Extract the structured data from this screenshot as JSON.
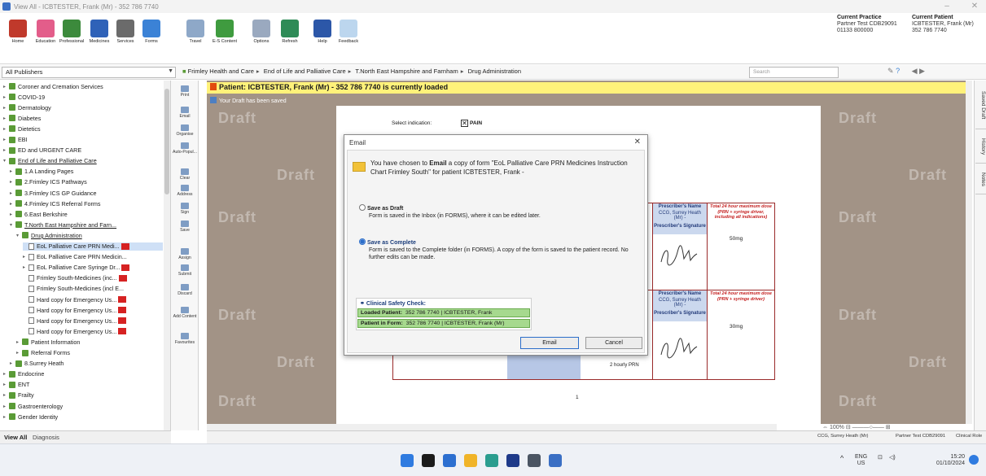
{
  "window": {
    "title": "View All - ICBTESTER, Frank (Mr) - 352 786 7740"
  },
  "ribbon": {
    "buttons": [
      "Home",
      "Education",
      "Professional",
      "Medicines",
      "Services",
      "Forms",
      "Travel",
      "E-S Content",
      "Options",
      "Refresh",
      "Help",
      "Feedback"
    ],
    "current_practice": {
      "heading": "Current Practice",
      "name": "Partner Test CDB29091",
      "phone": "01133 800000"
    },
    "current_patient": {
      "heading": "Current Patient",
      "name": "ICBTESTER, Frank (Mr)",
      "number": "352 786 7740"
    }
  },
  "navbar": {
    "publisher": "All Publishers",
    "breadcrumbs": [
      "Frimley Health and Care",
      "End of Life and Palliative Care",
      "T.North East Hampshire and Farnham",
      "Drug Administration"
    ],
    "search_placeholder": "Search"
  },
  "tree": {
    "items": [
      {
        "label": "Coroner and Cremation Services",
        "level": 1,
        "kind": "book",
        "expand": "▸"
      },
      {
        "label": "COVID-19",
        "level": 1,
        "kind": "book",
        "expand": "▸"
      },
      {
        "label": "Dermatology",
        "level": 1,
        "kind": "book",
        "expand": "▸"
      },
      {
        "label": "Diabetes",
        "level": 1,
        "kind": "book",
        "expand": "▸"
      },
      {
        "label": "Dietetics",
        "level": 1,
        "kind": "book",
        "expand": "▸"
      },
      {
        "label": "EBI",
        "level": 1,
        "kind": "book",
        "expand": "▸"
      },
      {
        "label": "ED and URGENT CARE",
        "level": 1,
        "kind": "book",
        "expand": "▸"
      },
      {
        "label": "End of Life and Palliative Care",
        "level": 1,
        "kind": "book",
        "expand": "▾",
        "link": true
      },
      {
        "label": "1.A Landing Pages",
        "level": 2,
        "kind": "book",
        "expand": "▸"
      },
      {
        "label": "2.Frimley ICS Pathways",
        "level": 2,
        "kind": "book",
        "expand": "▸"
      },
      {
        "label": "3.Frimley ICS GP Guidance",
        "level": 2,
        "kind": "book",
        "expand": "▸"
      },
      {
        "label": "4.Frimley ICS Referral Forms",
        "level": 2,
        "kind": "book",
        "expand": "▸"
      },
      {
        "label": "6.East Berkshire",
        "level": 2,
        "kind": "book",
        "expand": "▸"
      },
      {
        "label": "T.North East Hampshire and Farn...",
        "level": 2,
        "kind": "book",
        "expand": "▾",
        "link": true
      },
      {
        "label": "Drug Administration",
        "level": 3,
        "kind": "book",
        "expand": "▾",
        "link": true
      },
      {
        "label": "EoL Palliative Care PRN Medi...",
        "level": 4,
        "kind": "doc",
        "expand": "",
        "red": true,
        "selected": true
      },
      {
        "label": "EoL Palliative Care PRN Medicin...",
        "level": 4,
        "kind": "doc",
        "expand": "▸"
      },
      {
        "label": "EoL Palliative Care Syringe Dr...",
        "level": 4,
        "kind": "doc",
        "expand": "▸",
        "red": true
      },
      {
        "label": "Frimley South-Medicines (inc...",
        "level": 4,
        "kind": "doc",
        "expand": "",
        "red": true
      },
      {
        "label": "Frimley South-Medicines (incl E...",
        "level": 4,
        "kind": "doc",
        "expand": ""
      },
      {
        "label": "Hard copy for Emergency Us...",
        "level": 4,
        "kind": "doc",
        "expand": "",
        "red": true
      },
      {
        "label": "Hard copy for Emergency Us...",
        "level": 4,
        "kind": "doc",
        "expand": "",
        "red": true
      },
      {
        "label": "Hard copy for Emergency Us...",
        "level": 4,
        "kind": "doc",
        "expand": "",
        "red": true
      },
      {
        "label": "Hard copy for Emergency Us...",
        "level": 4,
        "kind": "doc",
        "expand": "",
        "red": true
      },
      {
        "label": "Patient Information",
        "level": 3,
        "kind": "book",
        "expand": "▸"
      },
      {
        "label": "Referral Forms",
        "level": 3,
        "kind": "book",
        "expand": "▸"
      },
      {
        "label": "8.Surrey Heath",
        "level": 2,
        "kind": "book",
        "expand": "▸"
      },
      {
        "label": "Endocrine",
        "level": 1,
        "kind": "book",
        "expand": "▸"
      },
      {
        "label": "ENT",
        "level": 1,
        "kind": "book",
        "expand": "▸"
      },
      {
        "label": "Frailty",
        "level": 1,
        "kind": "book",
        "expand": "▸"
      },
      {
        "label": "Gastroenterology",
        "level": 1,
        "kind": "book",
        "expand": "▸"
      },
      {
        "label": "Gender Identity",
        "level": 1,
        "kind": "book",
        "expand": "▸"
      }
    ],
    "footer_tab_active": "View All",
    "footer_tab_other": "Diagnosis"
  },
  "vtoolbar": [
    "Print",
    "Email",
    "Organise",
    "Auto-Popul...",
    "Clear",
    "Address",
    "Sign",
    "Save",
    "Assign",
    "Submit",
    "Discard",
    "Add Content",
    "Favourites"
  ],
  "banner": {
    "text": "Patient: ICBTESTER, Frank (Mr) - 352 786 7740 is currently loaded"
  },
  "saved_notice": "Your Draft has been saved",
  "watermark": "Draft",
  "form": {
    "select_indication_label": "Select indication:",
    "indication": "PAIN",
    "prescriber_name_hdr": "Prescriber's Name",
    "prescriber_name_val": "CCG, Surrey Heath (Mr) -",
    "prescriber_sig_hdr": "Prescriber's Signature",
    "total_dose_hdr_1": "Total 24 hour maximum dose (PRN + syringe driver, including all indications)",
    "total_dose_hdr_2": "Total 24 hour maximum dose (PRN + syringe driver)",
    "dose_1": "50mg",
    "dose_2": "30mg",
    "freq_text": "2 hourly PRN",
    "page_number": "1"
  },
  "dialog": {
    "title": "Email",
    "message_pre": "You have chosen to ",
    "message_bold": "Email",
    "message_post": " a copy of form \"EoL Palliative Care PRN Medicines Instruction Chart Frimley South\" for patient ICBTESTER, Frank -",
    "option_draft_title": "Save as Draft",
    "option_draft_desc": "Form is saved in the Inbox (in FORMS), where it can be edited later.",
    "option_complete_title": "Save as Complete",
    "option_complete_desc": "Form is saved to the Complete folder (in FORMS). A copy of the form is saved to the patient record. No further edits can be made.",
    "selected_option": "complete",
    "safety_heading": "Clinical Safety Check:",
    "loaded_label": "Loaded Patient:",
    "loaded_value": "352 786 7740 | ICBTESTER, Frank",
    "form_label": "Patient in Form:",
    "form_value": "352 786 7740 | ICBTESTER, Frank (Mr)",
    "email_button": "Email",
    "cancel_button": "Cancel"
  },
  "right_tabs": [
    "Saved Draft",
    "History",
    "Notes"
  ],
  "zoom": "100%",
  "statusbar": [
    "CCG, Surrey Heath (Mr)",
    "Partner Test CDB29091",
    "Clinical Role"
  ],
  "taskbar": {
    "lang": "ENG",
    "locale": "US",
    "time": "15:20",
    "date": "01/10/2024"
  },
  "colors": {
    "banner": "#fff27a",
    "draft_bg": "#a29386",
    "accent": "#2b6dc9",
    "safety_green": "#a6d98e",
    "tree_book": "#5a9b36",
    "red_tag": "#d62222"
  }
}
